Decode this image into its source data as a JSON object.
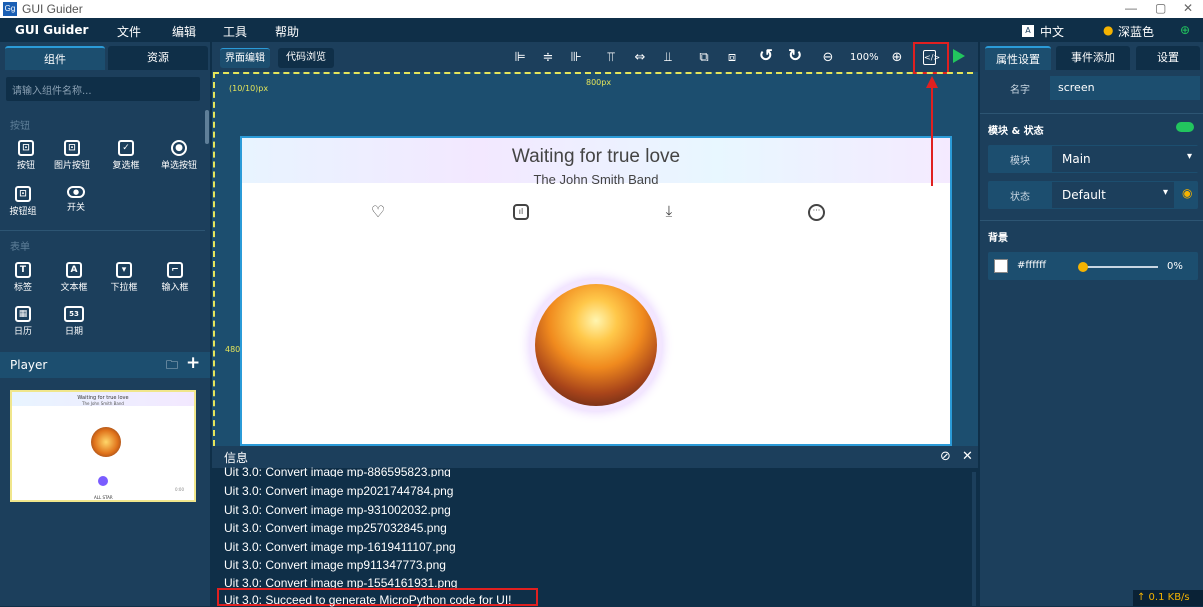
{
  "window": {
    "app_icon": "Gg",
    "title": "GUI Guider",
    "minimize": "—",
    "maximize": "▢",
    "close": "✕"
  },
  "menu": {
    "app_name": "GUI Guider",
    "items": [
      "文件",
      "编辑",
      "工具",
      "帮助"
    ],
    "language": "中文",
    "theme": "深蓝色"
  },
  "left": {
    "tabs": [
      "组件",
      "资源"
    ],
    "search_placeholder": "请输入组件名称...",
    "section_buttons": "按钮",
    "buttons": [
      {
        "label": "按钮",
        "icon": "button-icon",
        "glyph": "⊡"
      },
      {
        "label": "图片按钮",
        "icon": "image-button-icon",
        "glyph": "⊡"
      },
      {
        "label": "复选框",
        "icon": "checkbox-icon",
        "glyph": "✓"
      },
      {
        "label": "单选按钮",
        "icon": "radio-icon",
        "glyph": "◉"
      },
      {
        "label": "按钮组",
        "icon": "button-group-icon",
        "glyph": "⊡"
      },
      {
        "label": "开关",
        "icon": "switch-icon",
        "glyph": "●"
      }
    ],
    "section_forms": "表单",
    "forms": [
      {
        "label": "标签",
        "icon": "label-icon",
        "glyph": "T"
      },
      {
        "label": "文本框",
        "icon": "textbox-icon",
        "glyph": "A"
      },
      {
        "label": "下拉框",
        "icon": "dropdown-icon",
        "glyph": "▾"
      },
      {
        "label": "输入框",
        "icon": "input-icon",
        "glyph": "⌐"
      },
      {
        "label": "日历",
        "icon": "calendar-icon",
        "glyph": "▦"
      },
      {
        "label": "日期",
        "icon": "date-icon",
        "glyph": "53"
      }
    ],
    "screen_list_title": "Player",
    "thumb": {
      "title": "Waiting for true love",
      "subtitle": "The John Smith Band",
      "caption": "ALL STAR",
      "time": "0:00"
    }
  },
  "center": {
    "tabs": [
      "界面编辑",
      "代码浏览"
    ],
    "zoom": "100%",
    "coord_label": "(10/10)px",
    "width_label": "800px",
    "height_label": "480p",
    "canvas": {
      "title": "Waiting for true love",
      "subtitle": "The John Smith Band"
    },
    "info": {
      "title": "信息",
      "logs": [
        "Uit 3.0: Convert image mp-886595823.png",
        "Uit 3.0: Convert image mp2021744784.png",
        "Uit 3.0: Convert image mp-931002032.png",
        "Uit 3.0: Convert image mp257032845.png",
        "Uit 3.0: Convert image mp-1619411107.png",
        "Uit 3.0: Convert image mp911347773.png",
        "Uit 3.0: Convert image mp-1554161931.png",
        "Uit 3.0: Succeed to generate MicroPython code for UI!"
      ]
    }
  },
  "right": {
    "tabs": [
      "属性设置",
      "事件添加",
      "设置"
    ],
    "name_label": "名字",
    "name_value": "screen",
    "module_state_title": "模块 & 状态",
    "module_label": "模块",
    "module_value": "Main",
    "state_label": "状态",
    "state_value": "Default",
    "bg_title": "背景",
    "bg_color": "#ffffff",
    "bg_opacity": "0%",
    "bg_opacity_value": 0,
    "net_speed": "↑ 0.1 KB/s"
  },
  "colors": {
    "accent": "#2b9bd8",
    "highlight": "#e02020",
    "run": "#22c55e"
  }
}
